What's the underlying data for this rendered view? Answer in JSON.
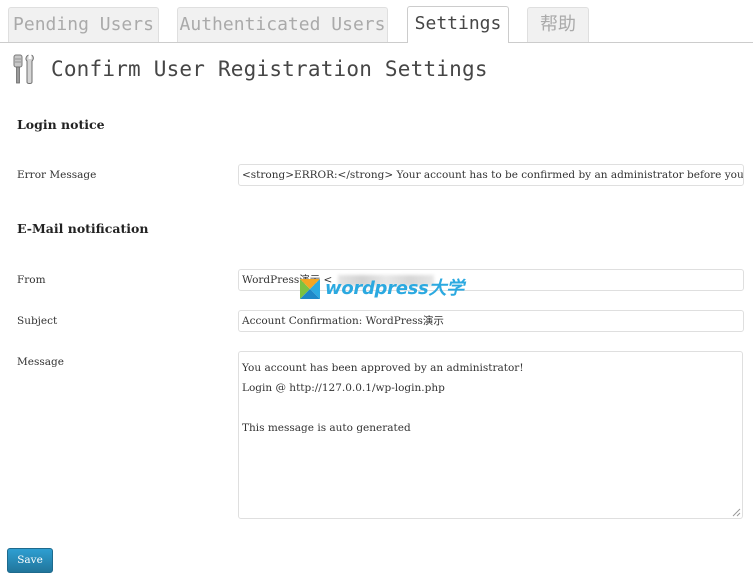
{
  "tabs": [
    {
      "label": "Pending Users",
      "active": false
    },
    {
      "label": "Authenticated Users",
      "active": false
    },
    {
      "label": "Settings",
      "active": true
    },
    {
      "label": "帮助",
      "active": false
    }
  ],
  "page": {
    "title": "Confirm User Registration Settings",
    "icon": "tools-icon"
  },
  "login_notice": {
    "heading": "Login notice",
    "error_message_label": "Error Message",
    "error_message_value": "<strong>ERROR:</strong> Your account has to be confirmed by an administrator before you can login"
  },
  "email_notification": {
    "heading": "E-Mail notification",
    "from_label": "From",
    "from_value": "WordPress演示 <",
    "subject_label": "Subject",
    "subject_value": "Account Confirmation: WordPress演示",
    "message_label": "Message",
    "message_lines": [
      "You account has been approved by an administrator!",
      "Login @ http://127.0.0.1/wp-login.php",
      "",
      "This message is auto generated"
    ]
  },
  "watermark": {
    "text": "wordpress大学"
  },
  "actions": {
    "save_label": "Save"
  },
  "colors": {
    "primary_button": "#21759b",
    "watermark_blue": "#2ba9e0",
    "input_border": "#dfdfdf"
  }
}
